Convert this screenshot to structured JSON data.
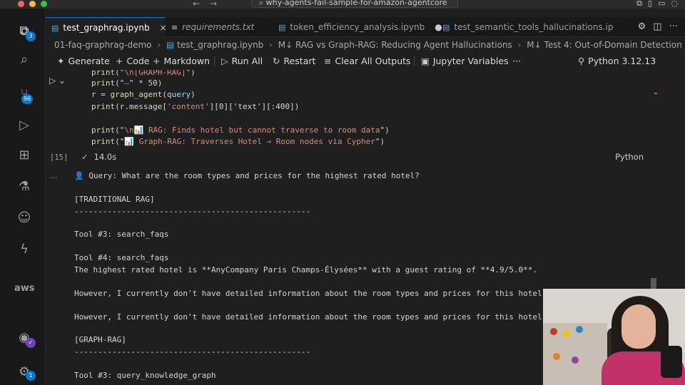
{
  "titlebar": {
    "search_text": "why-agents-fail-sample-for-amazon-agentcore"
  },
  "activity_bar": {
    "badges": {
      "explorer": "3",
      "source_control": "96",
      "accounts": "✓",
      "settings": "1"
    },
    "aws_label": "aws"
  },
  "tabs": [
    {
      "label": "test_graphrag.ipynb",
      "active": true
    },
    {
      "label": "requirements.txt",
      "italic": true
    },
    {
      "label": "token_efficiency_analysis.ipynb",
      "modified": true
    },
    {
      "label": "test_semantic_tools_hallucinations.ip"
    }
  ],
  "breadcrumb": {
    "items": [
      "01-faq-graphrag-demo",
      "test_graphrag.ipynb",
      "RAG vs Graph-RAG: Reducing Agent Hallucinations",
      "Test 4: Out-of-Domain Detection"
    ],
    "md_marker": "M↓"
  },
  "toolbar": {
    "generate": "Generate",
    "code": "Code",
    "markdown": "Markdown",
    "run_all": "Run All",
    "restart": "Restart",
    "clear_outputs": "Clear All Outputs",
    "variables": "Jupyter Variables",
    "more": "···",
    "kernel": "Python 3.12.13"
  },
  "code_cell": {
    "lines": [
      {
        "fn": "print",
        "open": "(\"",
        "str": "\\n[GRAPH-RAG]",
        "close": "\")"
      },
      {
        "fn": "print",
        "open": "(\"",
        "str": "—",
        "close": "\" * 50)"
      },
      {
        "plain_pre": "r = ",
        "fn": "graph_agent",
        "open": "(",
        "var": "query",
        "close": ")"
      },
      {
        "fn": "print",
        "open": "(r.message[",
        "str": "'content'",
        "close": "][0]['text'][:400])"
      },
      {
        "fn": "print",
        "open": "(\"",
        "str": "\\n📊 RAG: Finds hotel but cannot traverse to room data",
        "close": "\")"
      },
      {
        "fn": "print",
        "open": "(\"",
        "str": "📊 Graph-RAG: Traverses Hotel → Room nodes via Cypher",
        "close": "\")"
      }
    ],
    "exec_count": "[15]",
    "duration": "14.0s",
    "language": "Python"
  },
  "output": {
    "lines": [
      "👤 Query: What are the room types and prices for the highest rated hotel?",
      "",
      "[TRADITIONAL RAG]",
      "--------------------------------------------------",
      "",
      "Tool #3: search_faqs",
      "",
      "Tool #4: search_faqs",
      "The highest rated hotel is **AnyCompany Paris Champs-Élysées** with a guest rating of **4.9/5.0**.",
      "",
      "However, I currently don't have detailed information about the room types and prices for this hotel.",
      "",
      "However, I currently don't have detailed information about the room types and prices for this hotel.",
      "",
      "[GRAPH-RAG]",
      "--------------------------------------------------",
      "",
      "Tool #3: query_knowledge_graph"
    ]
  }
}
